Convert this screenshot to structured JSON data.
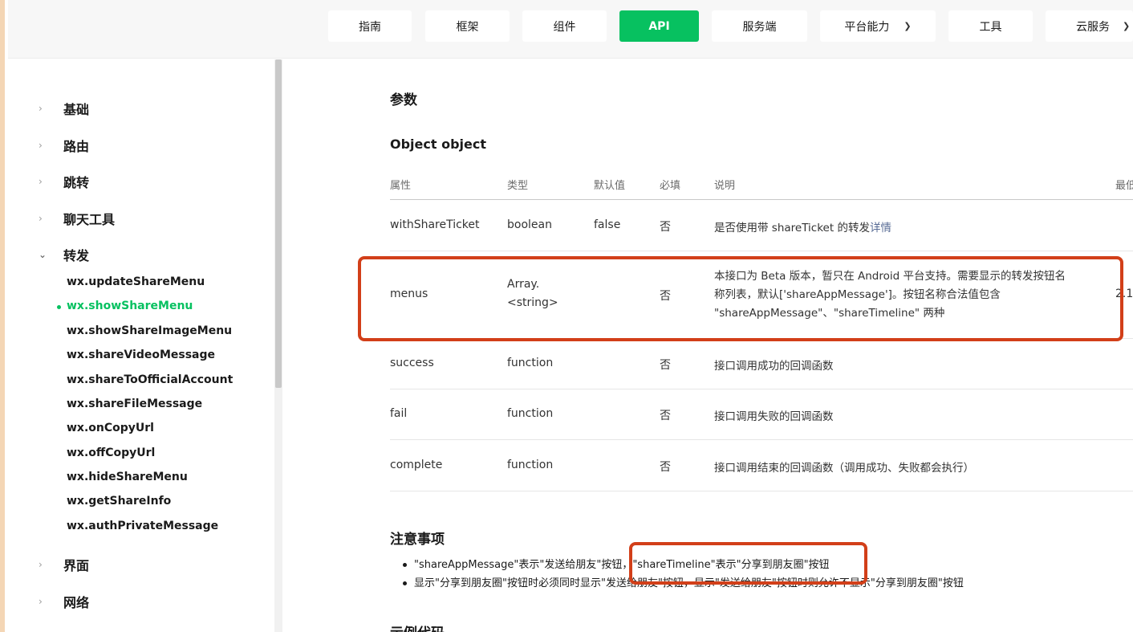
{
  "nav": {
    "items": [
      {
        "label": "指南"
      },
      {
        "label": "框架"
      },
      {
        "label": "组件"
      },
      {
        "label": "API"
      },
      {
        "label": "服务端"
      },
      {
        "label": "平台能力"
      },
      {
        "label": "工具"
      },
      {
        "label": "云服务"
      }
    ],
    "active": "API",
    "accent": "#07c160"
  },
  "sidebar": {
    "groups": [
      {
        "label": "基础"
      },
      {
        "label": "路由"
      },
      {
        "label": "跳转"
      },
      {
        "label": "聊天工具"
      },
      {
        "label": "转发"
      },
      {
        "label": "界面"
      },
      {
        "label": "网络"
      }
    ],
    "items": [
      {
        "label": "wx.updateShareMenu"
      },
      {
        "label": "wx.showShareMenu"
      },
      {
        "label": "wx.showShareImageMenu"
      },
      {
        "label": "wx.shareVideoMessage"
      },
      {
        "label": "wx.shareToOfficialAccount"
      },
      {
        "label": "wx.shareFileMessage"
      },
      {
        "label": "wx.onCopyUrl"
      },
      {
        "label": "wx.offCopyUrl"
      },
      {
        "label": "wx.hideShareMenu"
      },
      {
        "label": "wx.getShareInfo"
      },
      {
        "label": "wx.authPrivateMessage"
      }
    ],
    "active_item": "wx.showShareMenu"
  },
  "main": {
    "params_title": "参数",
    "object_title": "Object object",
    "table": {
      "headers": [
        "属性",
        "类型",
        "默认值",
        "必填",
        "说明",
        "最低"
      ],
      "rows": [
        {
          "name": "withShareTicket",
          "type": "boolean",
          "default": "false",
          "required": "否",
          "desc": "是否使用带 shareTicket 的转发",
          "link": "详情"
        },
        {
          "name": "menus",
          "type_line1": "Array.",
          "type_line2": "<string>",
          "default": "",
          "required": "否",
          "desc_line1": "本接口为 Beta 版本，暂只在 Android 平台支持。需要显示的转发按钮名",
          "desc_line2": "称列表，默认['shareAppMessage']。按钮名称合法值包含",
          "desc_line3": "\"shareAppMessage\"、\"shareTimeline\" 两种",
          "extra": "2.1"
        },
        {
          "name": "success",
          "type": "function",
          "default": "",
          "required": "否",
          "desc": "接口调用成功的回调函数"
        },
        {
          "name": "fail",
          "type": "function",
          "default": "",
          "required": "否",
          "desc": "接口调用失败的回调函数"
        },
        {
          "name": "complete",
          "type": "function",
          "default": "",
          "required": "否",
          "desc": "接口调用结束的回调函数（调用成功、失败都会执行）"
        }
      ]
    },
    "notes_title": "注意事项",
    "notes": [
      "\"shareAppMessage\"表示\"发送给朋友\"按钮，\"shareTimeline\"表示\"分享到朋友圈\"按钮",
      "显示\"分享到朋友圈\"按钮时必须同时显示\"发送给朋友\"按钮，显示\"发送给朋友\"按钮时则允许不显示\"分享到朋友圈\"按钮"
    ],
    "next_title": "示例代码",
    "highlight_color": "#d23f19"
  }
}
